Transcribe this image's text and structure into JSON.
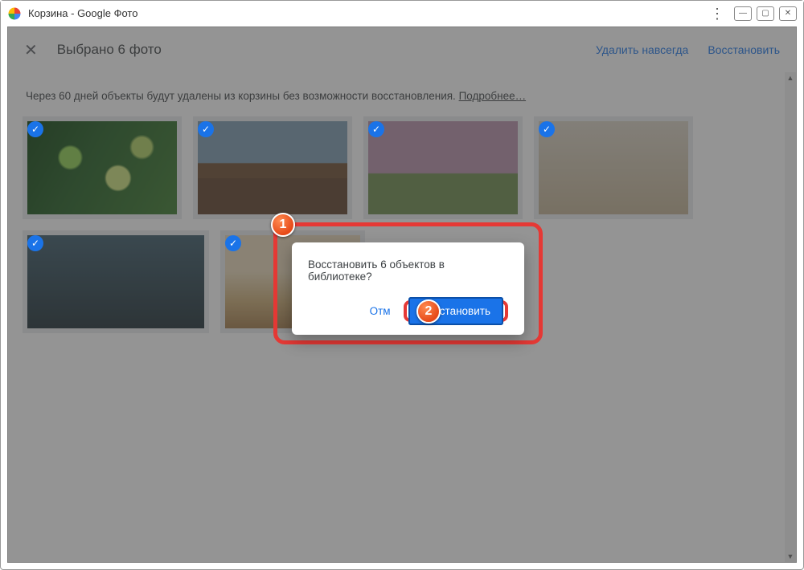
{
  "window": {
    "title": "Корзина - Google Фото"
  },
  "bar": {
    "title": "Выбрано 6 фото",
    "delete": "Удалить навсегда",
    "restore": "Восстановить"
  },
  "notice": {
    "text": "Через 60 дней объекты будут удалены из корзины без возможности восстановления. ",
    "more": "Подробнее…"
  },
  "dialog": {
    "message": "Восстановить 6 объектов в библиотеке?",
    "cancel": "Отм",
    "restore": "Восстановить"
  },
  "badges": {
    "b1": "1",
    "b2": "2"
  }
}
